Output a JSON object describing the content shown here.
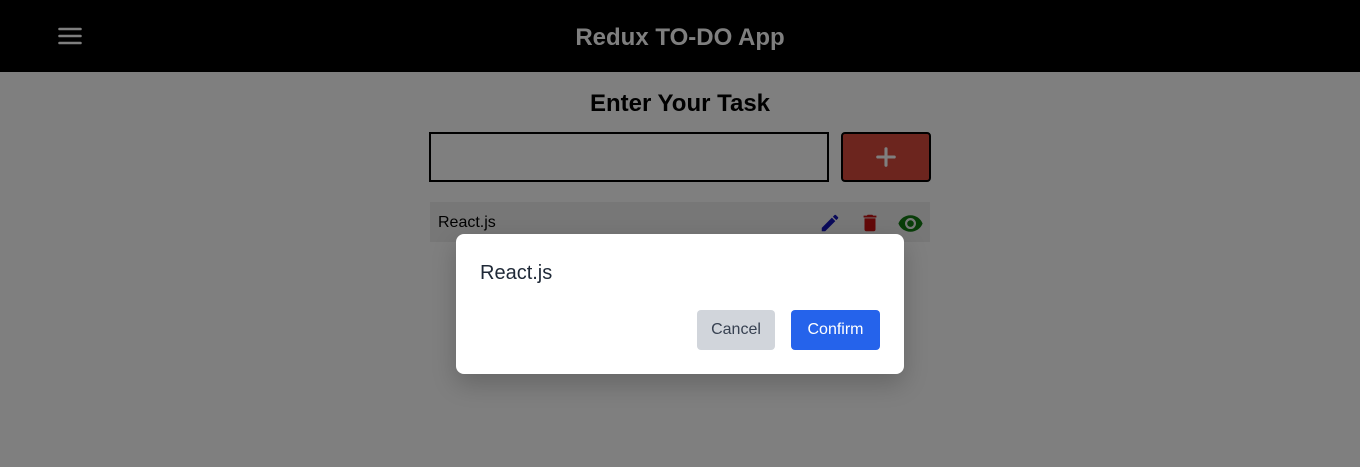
{
  "header": {
    "title": "Redux TO-DO App",
    "menu_icon": "hamburger-menu-icon"
  },
  "form": {
    "heading": "Enter Your Task",
    "input_value": "",
    "add_icon": "plus-icon"
  },
  "todos": [
    {
      "label": "React.js",
      "actions": [
        "pencil-icon",
        "trash-icon",
        "eye-icon"
      ]
    }
  ],
  "dialog": {
    "message": "React.js",
    "cancel_label": "Cancel",
    "confirm_label": "Confirm"
  },
  "colors": {
    "header_bg": "#000000",
    "add_button": "#d84a3c",
    "edit_icon": "#1515b5",
    "delete_icon": "#c51212",
    "view_icon": "#127a12",
    "confirm_button": "#2563eb",
    "cancel_button": "#d1d5db"
  }
}
